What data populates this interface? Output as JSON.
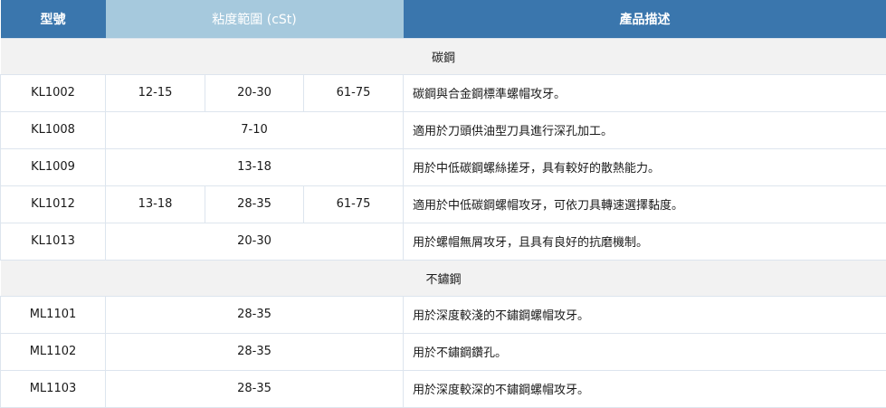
{
  "header": {
    "model": "型號",
    "viscosity": "粘度範圍 (cSt)",
    "description": "產品描述"
  },
  "sections": [
    {
      "title": "碳鋼",
      "rows": [
        {
          "model": "KL1002",
          "values": [
            "12-15",
            "20-30",
            "61-75"
          ],
          "desc": "碳鋼與合金鋼標準螺帽攻牙。"
        },
        {
          "model": "KL1008",
          "values": [
            "7-10"
          ],
          "desc": "適用於刀頭供油型刀具進行深孔加工。"
        },
        {
          "model": "KL1009",
          "values": [
            "13-18"
          ],
          "desc": "用於中低碳鋼螺絲搓牙，具有較好的散熱能力。"
        },
        {
          "model": "KL1012",
          "values": [
            "13-18",
            "28-35",
            "61-75"
          ],
          "desc": "適用於中低碳鋼螺帽攻牙，可依刀具轉速選擇黏度。"
        },
        {
          "model": "KL1013",
          "values": [
            "20-30"
          ],
          "desc": "用於螺帽無屑攻牙，且具有良好的抗磨機制。"
        }
      ]
    },
    {
      "title": "不鏽鋼",
      "rows": [
        {
          "model": "ML1101",
          "values": [
            "28-35"
          ],
          "desc": "用於深度較淺的不鏽鋼螺帽攻牙。"
        },
        {
          "model": "ML1102",
          "values": [
            "28-35"
          ],
          "desc": "用於不鏽鋼鑽孔。"
        },
        {
          "model": "ML1103",
          "values": [
            "28-35"
          ],
          "desc": "用於深度較深的不鏽鋼螺帽攻牙。"
        }
      ]
    }
  ]
}
